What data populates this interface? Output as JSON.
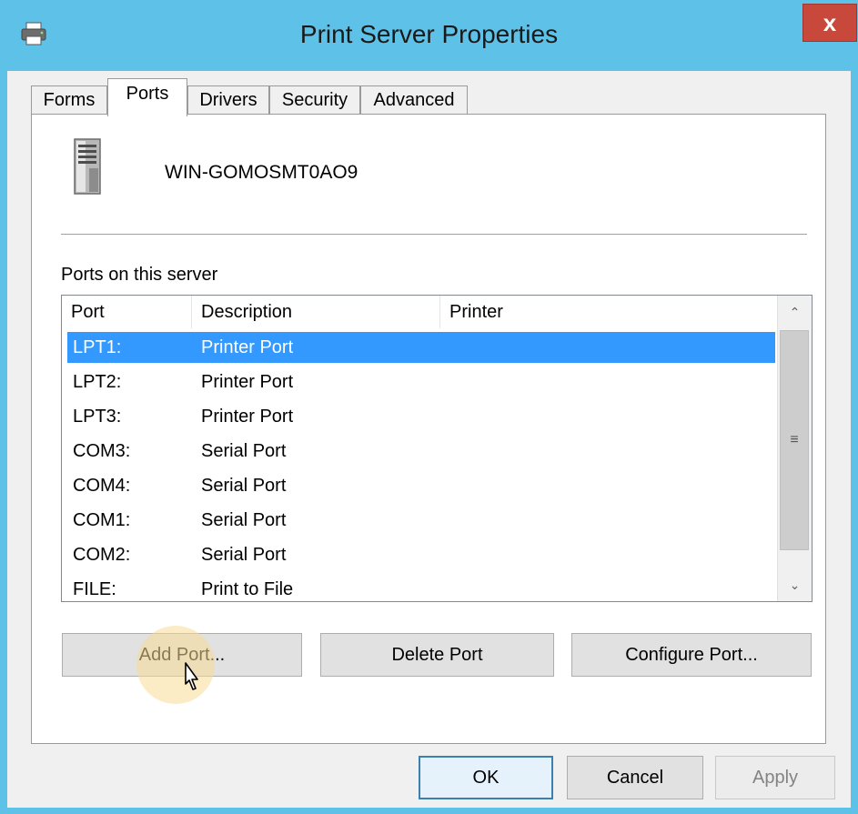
{
  "window": {
    "title": "Print Server Properties",
    "close_label": "x"
  },
  "tabs": [
    {
      "label": "Forms",
      "active": false
    },
    {
      "label": "Ports",
      "active": true
    },
    {
      "label": "Drivers",
      "active": false
    },
    {
      "label": "Security",
      "active": false
    },
    {
      "label": "Advanced",
      "active": false
    }
  ],
  "server": {
    "name": "WIN-GOMOSMT0AO9"
  },
  "ports_section": {
    "label": "Ports on this server",
    "columns": [
      "Port",
      "Description",
      "Printer"
    ],
    "rows": [
      {
        "port": "LPT1:",
        "description": "Printer Port",
        "printer": "",
        "selected": true
      },
      {
        "port": "LPT2:",
        "description": "Printer Port",
        "printer": "",
        "selected": false
      },
      {
        "port": "LPT3:",
        "description": "Printer Port",
        "printer": "",
        "selected": false
      },
      {
        "port": "COM3:",
        "description": "Serial Port",
        "printer": "",
        "selected": false
      },
      {
        "port": "COM4:",
        "description": "Serial Port",
        "printer": "",
        "selected": false
      },
      {
        "port": "COM1:",
        "description": "Serial Port",
        "printer": "",
        "selected": false
      },
      {
        "port": "COM2:",
        "description": "Serial Port",
        "printer": "",
        "selected": false
      },
      {
        "port": "FILE:",
        "description": "Print to File",
        "printer": "",
        "selected": false
      }
    ]
  },
  "port_buttons": {
    "add": "Add Port...",
    "delete": "Delete Port",
    "configure": "Configure Port..."
  },
  "dialog_buttons": {
    "ok": "OK",
    "cancel": "Cancel",
    "apply": "Apply"
  },
  "colors": {
    "titlebar": "#5ec2e8",
    "close": "#c9483c",
    "selection": "#3399ff"
  }
}
